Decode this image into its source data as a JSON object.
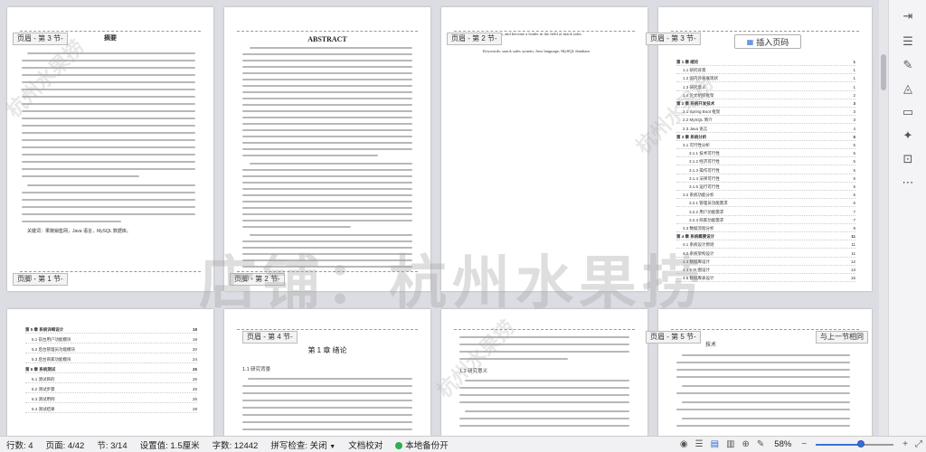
{
  "document": {
    "page1": {
      "header_tag": "页眉 - 第 3 节-",
      "title": "摘要",
      "footer_tag": "页脚 - 第 1 节-",
      "keywords": "关键词：果蔬销售网，Java 语言，MySQL 数据库。"
    },
    "page2": {
      "title": "ABSTRACT",
      "footer_tag": "页脚 - 第 2 节-"
    },
    "page3": {
      "header_tag": "页眉 - 第 2 节-",
      "line1": "efficiency, and innovation, and become a leader in the field of mack sales",
      "keywords": "Keywords: snack sales system, Java language, MySQL database."
    },
    "page4": {
      "header_tag": "页眉 - 第 3 节-",
      "insert_page_number": "插入页码",
      "toc": [
        {
          "text": "第 1 章  绪论",
          "page": "1",
          "bold": true
        },
        {
          "text": "1.1 研究背景",
          "page": "1"
        },
        {
          "text": "1.2 国内外发展现状",
          "page": "1"
        },
        {
          "text": "1.3 研究意义",
          "page": "1"
        },
        {
          "text": "1.4 论文组织框架",
          "page": "2"
        },
        {
          "text": "第 2 章  系统开发技术",
          "page": "3",
          "bold": true
        },
        {
          "text": "2.1 Spring Boot 框架",
          "page": "3"
        },
        {
          "text": "2.2 MySQL 简介",
          "page": "3"
        },
        {
          "text": "2.3 Java 语言",
          "page": "4"
        },
        {
          "text": "第 3 章  系统分析",
          "page": "5",
          "bold": true
        },
        {
          "text": "3.1 可行性分析",
          "page": "5"
        },
        {
          "text": "3.1.1 技术可行性",
          "page": "5"
        },
        {
          "text": "3.1.2 经济可行性",
          "page": "5"
        },
        {
          "text": "3.1.3 操作可行性",
          "page": "5"
        },
        {
          "text": "3.1.4 法律可行性",
          "page": "6"
        },
        {
          "text": "3.1.5 运行可行性",
          "page": "6"
        },
        {
          "text": "3.2 系统功能分析",
          "page": "6"
        },
        {
          "text": "3.2.1 管理员功能需求",
          "page": "6"
        },
        {
          "text": "3.2.2 用户功能需求",
          "page": "7"
        },
        {
          "text": "3.2.3 商家功能需求",
          "page": "7"
        },
        {
          "text": "3.3 数据流程分析",
          "page": "9"
        },
        {
          "text": "第 4 章  系统概要设计",
          "page": "11",
          "bold": true
        },
        {
          "text": "4.1 系统设计原则",
          "page": "11"
        },
        {
          "text": "4.2 系统架构设计",
          "page": "11"
        },
        {
          "text": "4.3 数据库设计",
          "page": "12"
        },
        {
          "text": "4.4 E-R 图设计",
          "page": "13"
        },
        {
          "text": "4.5 数据库表设计",
          "page": "15"
        }
      ]
    },
    "page5": {
      "toc": [
        {
          "text": "第 5 章  系统详细设计",
          "page": "18",
          "bold": true
        },
        {
          "text": "5.1 前台用户功能模块",
          "page": "18"
        },
        {
          "text": "5.2 后台管理员功能模块",
          "page": "20"
        },
        {
          "text": "5.3 后台商家功能模块",
          "page": "24"
        },
        {
          "text": "第 6 章  系统测试",
          "page": "26",
          "bold": true
        },
        {
          "text": "6.1 测试目的",
          "page": "26"
        },
        {
          "text": "6.2 测试步骤",
          "page": "26"
        },
        {
          "text": "6.3 测试用例",
          "page": "26"
        },
        {
          "text": "6.4 测试结果",
          "page": "28"
        }
      ]
    },
    "page6": {
      "header_tag": "页眉 - 第 4 节-",
      "chapter": "第 1 章  绪论",
      "section": "1.1 研究背景"
    },
    "page7": {
      "section": "1.3 研究意义"
    },
    "page8": {
      "header_tag": "页眉 - 第 5 节-",
      "link_prev": "与上一节相同",
      "title_frag": "技术"
    },
    "watermark": "店铺：杭州水果捞",
    "watermark_side": "杭州水果捞"
  },
  "sidebar": {
    "icons": [
      "collapse-panel-icon",
      "hamburger-menu-icon",
      "pen-icon",
      "shapes-icon",
      "card-icon",
      "magic-wand-icon",
      "toolbox-icon",
      "more-icon"
    ]
  },
  "status": {
    "rows": "行数: 4",
    "page": "页面: 4/42",
    "section": "节: 3/14",
    "setting": "设置值: 1.5厘米",
    "words": "字数: 12442",
    "spellcheck": "拼写检查: 关闭",
    "proofread": "文档校对",
    "backup": "本地备份开",
    "zoom": "58%",
    "zoom_level": 0.58
  }
}
